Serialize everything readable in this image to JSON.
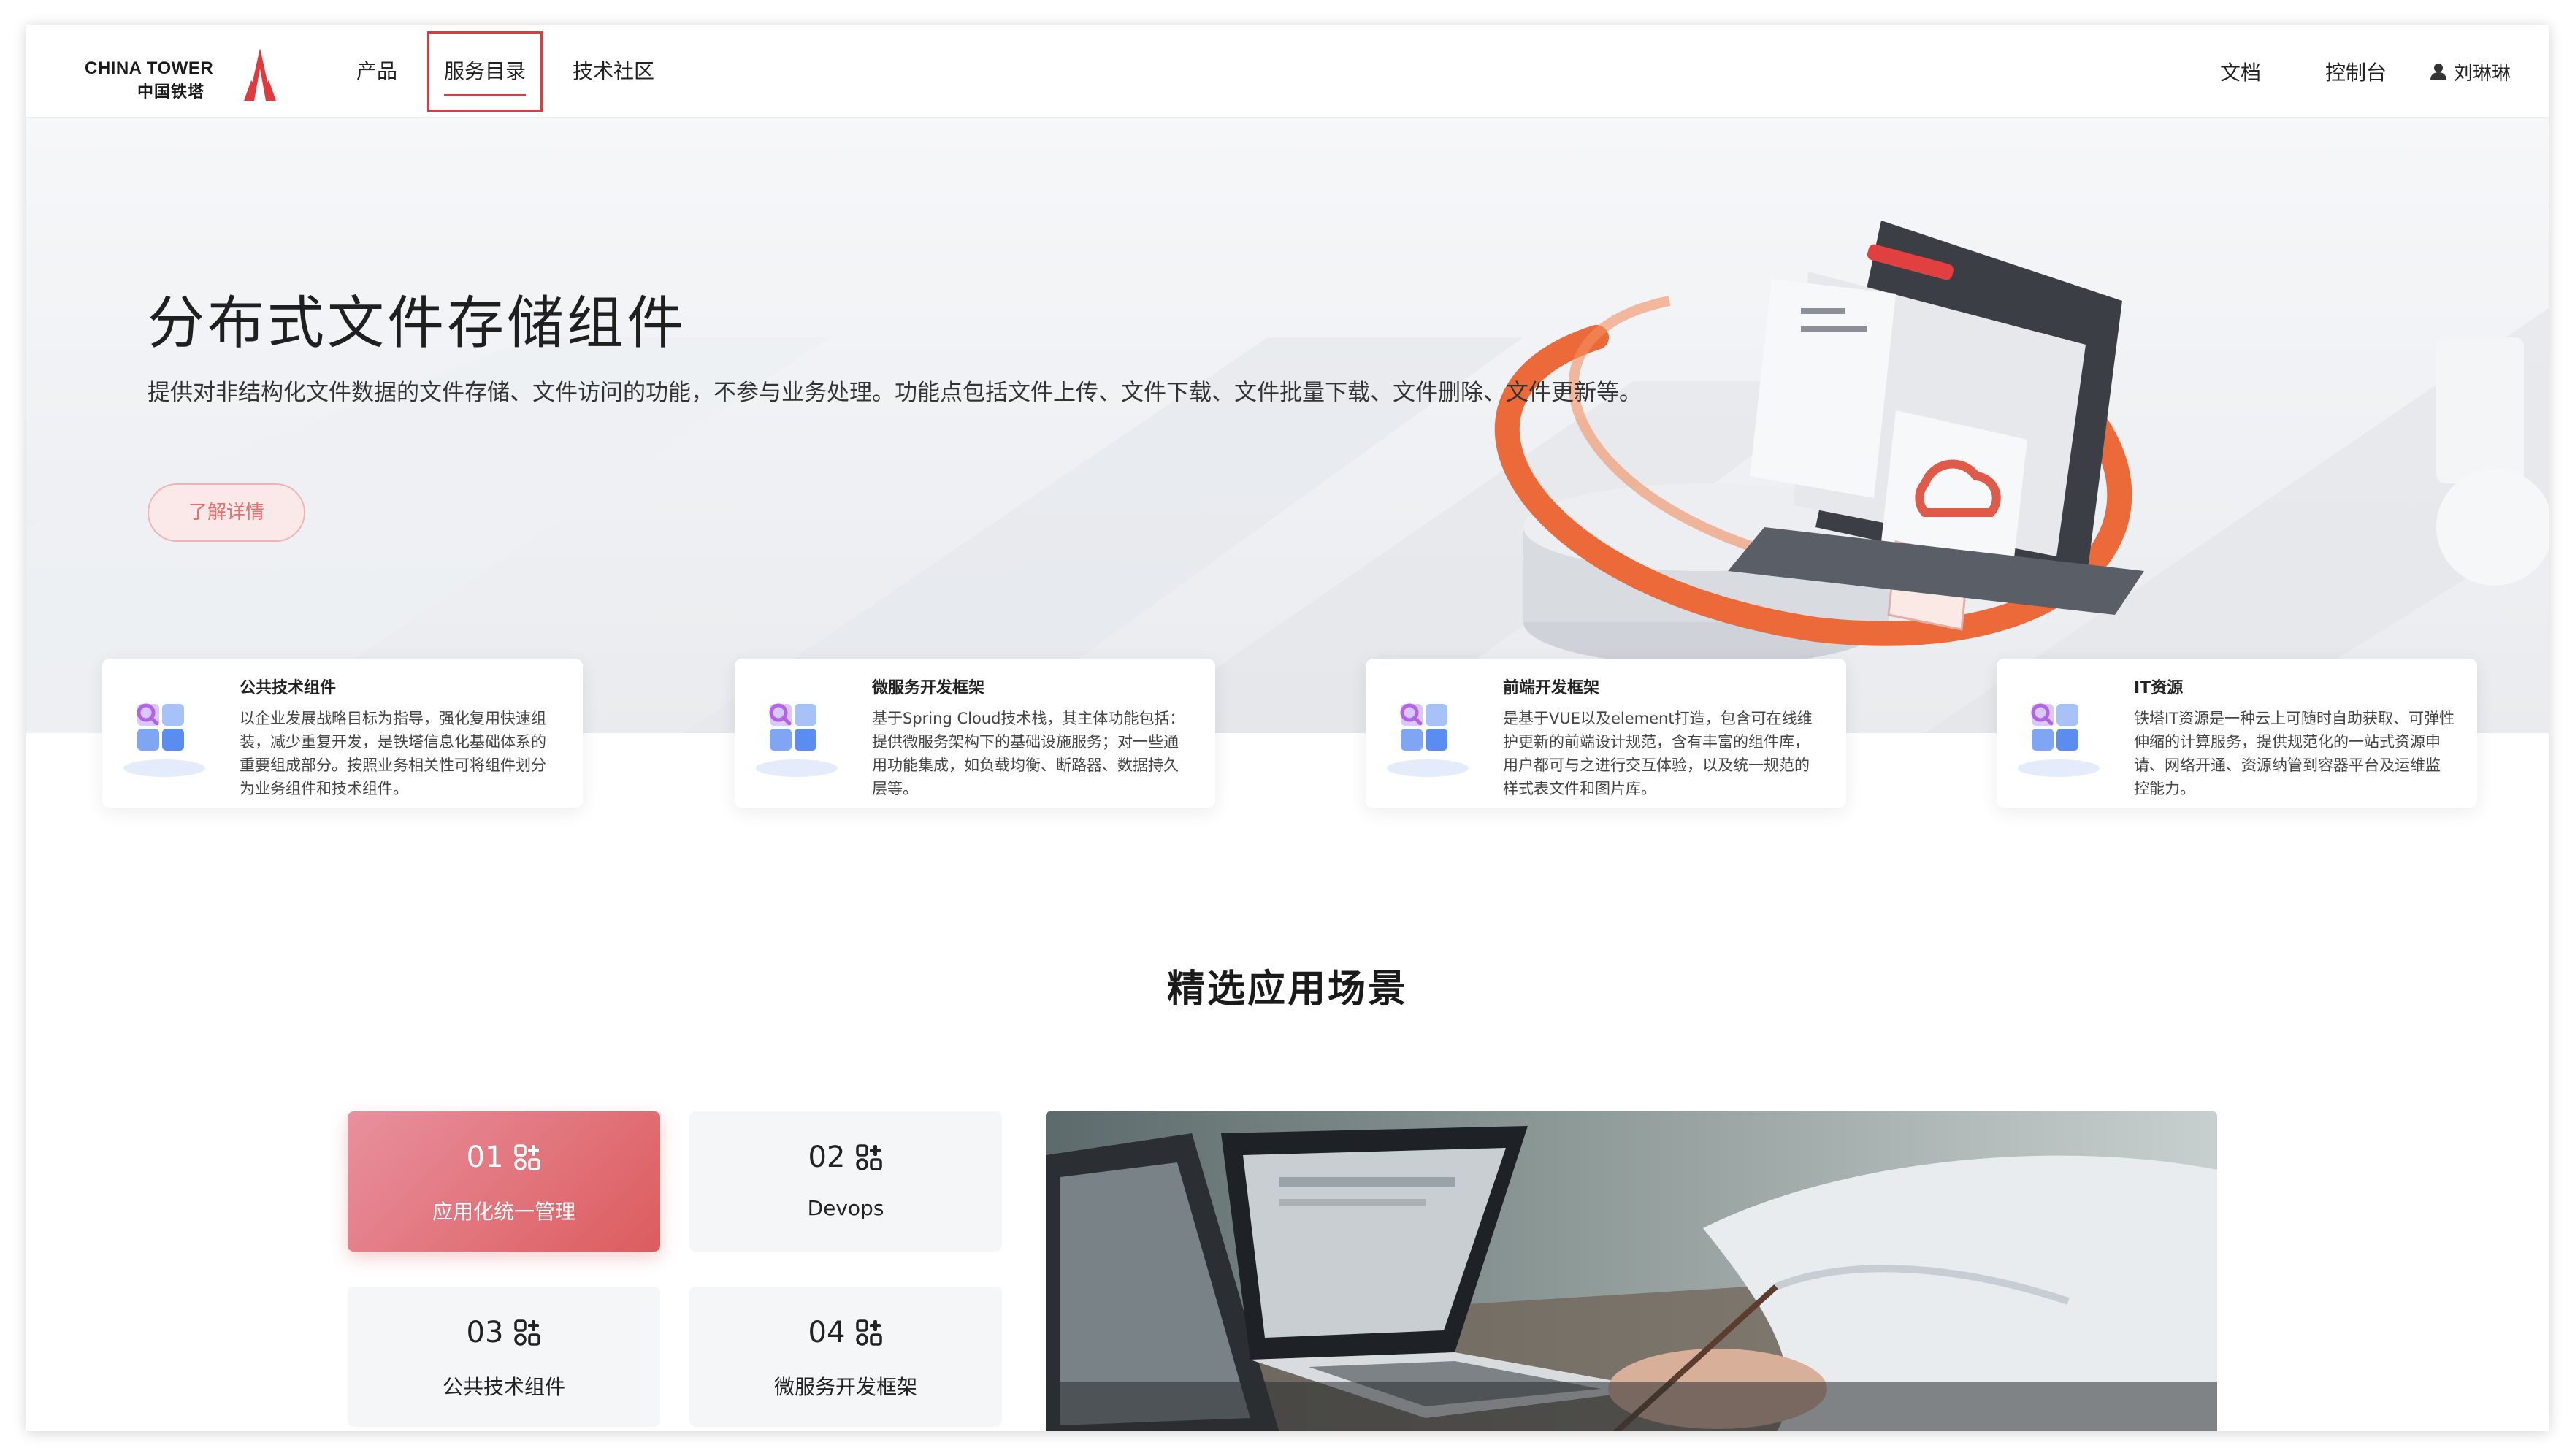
{
  "header": {
    "logo_en": "CHINA TOWER",
    "logo_cn": "中国铁塔",
    "nav": [
      "产品",
      "服务目录",
      "技术社区"
    ],
    "active_nav": "服务目录",
    "docs": "文档",
    "console": "控制台",
    "user_name": "刘琳琳",
    "user_icon": "user-icon"
  },
  "hero": {
    "title": "分布式文件存储组件",
    "description": "提供对非结构化文件数据的文件存储、文件访问的功能，不参与业务处理。功能点包括文件上传、文件下载、文件批量下载、文件删除、文件更新等。",
    "button": "了解详情"
  },
  "cards": [
    {
      "title": "公共技术组件",
      "text": "以企业发展战略目标为指导，强化复用快速组装，减少重复开发，是铁塔信息化基础体系的重要组成部分。按照业务相关性可将组件划分为业务组件和技术组件。",
      "icon": "component-blocks-icon"
    },
    {
      "title": "微服务开发框架",
      "text": "基于Spring Cloud技术栈，其主体功能包括：提供微服务架构下的基础设施服务；对一些通用功能集成，如负载均衡、断路器、数据持久层等。",
      "icon": "component-blocks-icon"
    },
    {
      "title": "前端开发框架",
      "text": "是基于VUE以及element打造，包含可在线维护更新的前端设计规范，含有丰富的组件库，用户都可与之进行交互体验，以及统一规范的样式表文件和图片库。",
      "icon": "component-blocks-icon"
    },
    {
      "title": "IT资源",
      "text": "铁塔IT资源是一种云上可随时自助获取、可弹性伸缩的计算服务，提供规范化的一站式资源申请、网络开通、资源纳管到容器平台及运维监控能力。",
      "icon": "component-blocks-icon"
    }
  ],
  "scenes": {
    "title": "精选应用场景",
    "tiles": [
      {
        "num": "01",
        "label": "应用化统一管理",
        "active": true
      },
      {
        "num": "02",
        "label": "Devops",
        "active": false
      },
      {
        "num": "03",
        "label": "公共技术组件",
        "active": false
      },
      {
        "num": "04",
        "label": "微服务开发框架",
        "active": false
      }
    ],
    "tile_icon": "apps-grid-icon"
  },
  "colors": {
    "brand_red": "#e03a3e",
    "tile_active_from": "#e8909e",
    "tile_active_to": "#dc5c5e"
  }
}
